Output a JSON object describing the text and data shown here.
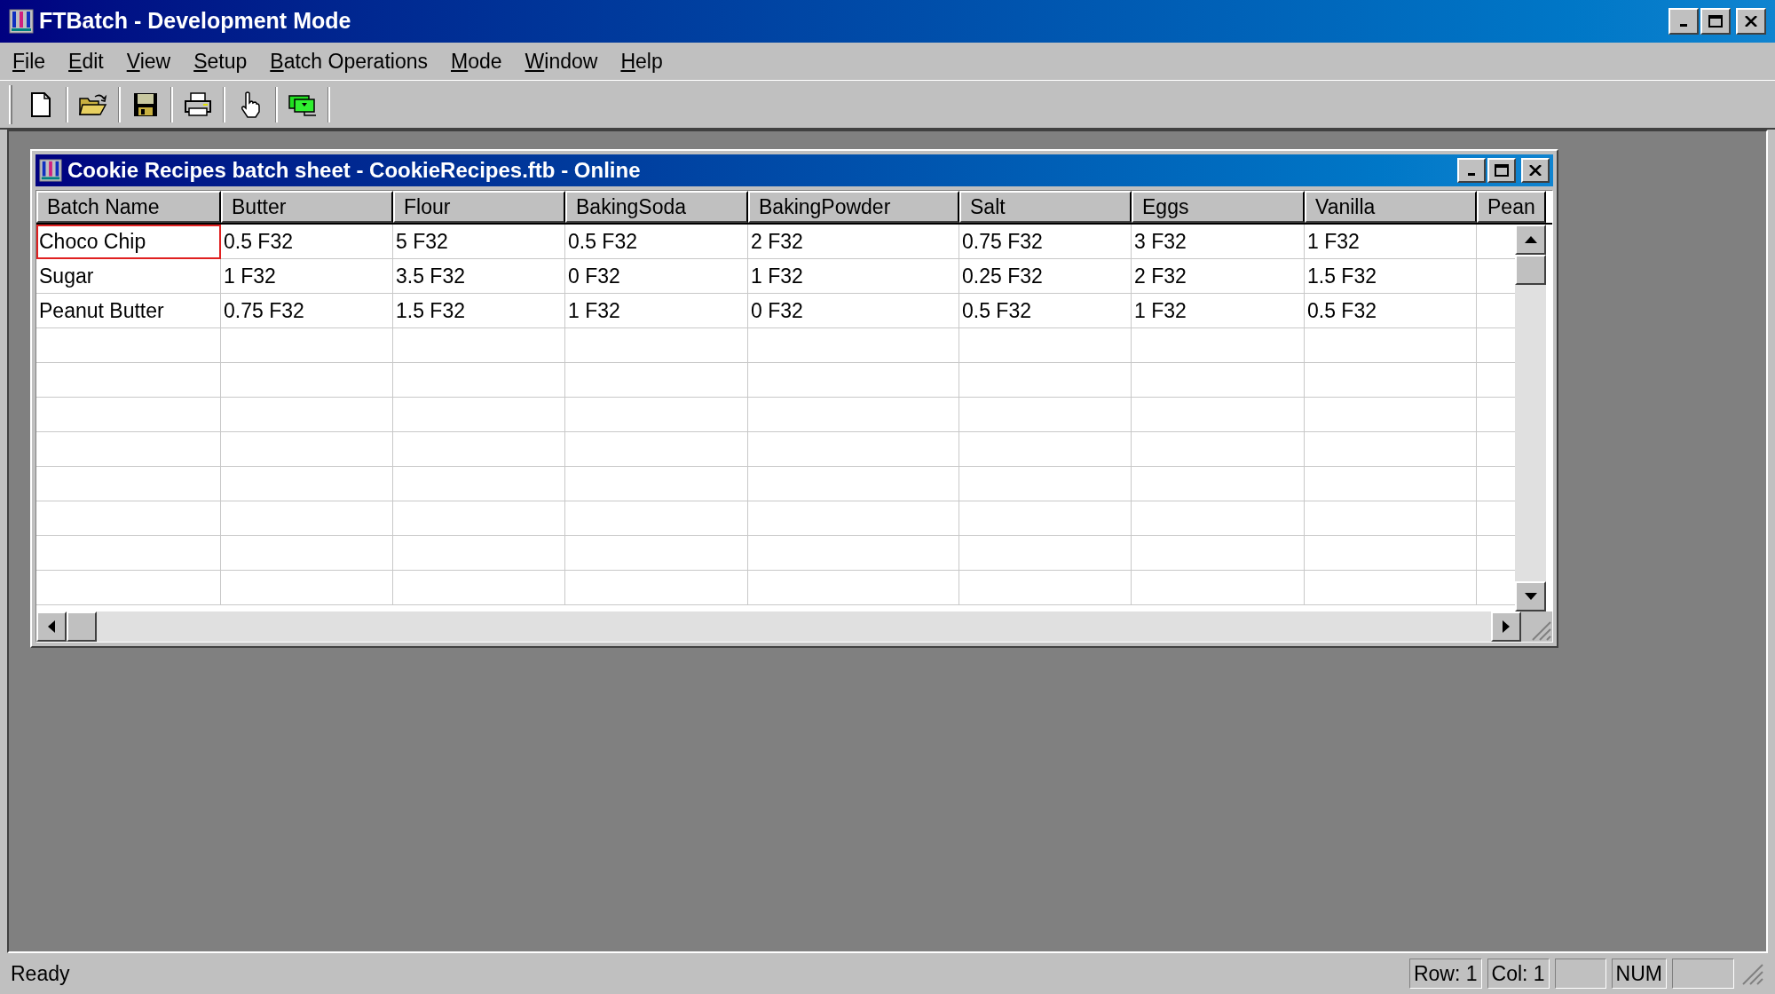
{
  "window": {
    "title": "FTBatch - Development Mode"
  },
  "menu": [
    "File",
    "Edit",
    "View",
    "Setup",
    "Batch Operations",
    "Mode",
    "Window",
    "Help"
  ],
  "child_window": {
    "title": "Cookie Recipes batch sheet - CookieRecipes.ftb - Online"
  },
  "table": {
    "columns": [
      "Batch Name",
      "Butter",
      "Flour",
      "BakingSoda",
      "BakingPowder",
      "Salt",
      "Eggs",
      "Vanilla",
      "Pean"
    ],
    "rows": [
      {
        "selected": true,
        "cells": [
          "Choco Chip",
          "0.5 F32",
          "5 F32",
          "0.5 F32",
          "2 F32",
          "0.75 F32",
          "3 F32",
          "1 F32"
        ]
      },
      {
        "selected": false,
        "cells": [
          "Sugar",
          "1 F32",
          "3.5 F32",
          "0 F32",
          "1 F32",
          "0.25 F32",
          "2 F32",
          "1.5 F32"
        ]
      },
      {
        "selected": false,
        "cells": [
          "Peanut Butter",
          "0.75 F32",
          "1.5 F32",
          "1 F32",
          "0 F32",
          "0.5 F32",
          "1 F32",
          "0.5 F32"
        ]
      }
    ]
  },
  "status_bar": {
    "message": "Ready",
    "panels": [
      "Row: 1",
      "Col: 1",
      "NUM"
    ]
  }
}
